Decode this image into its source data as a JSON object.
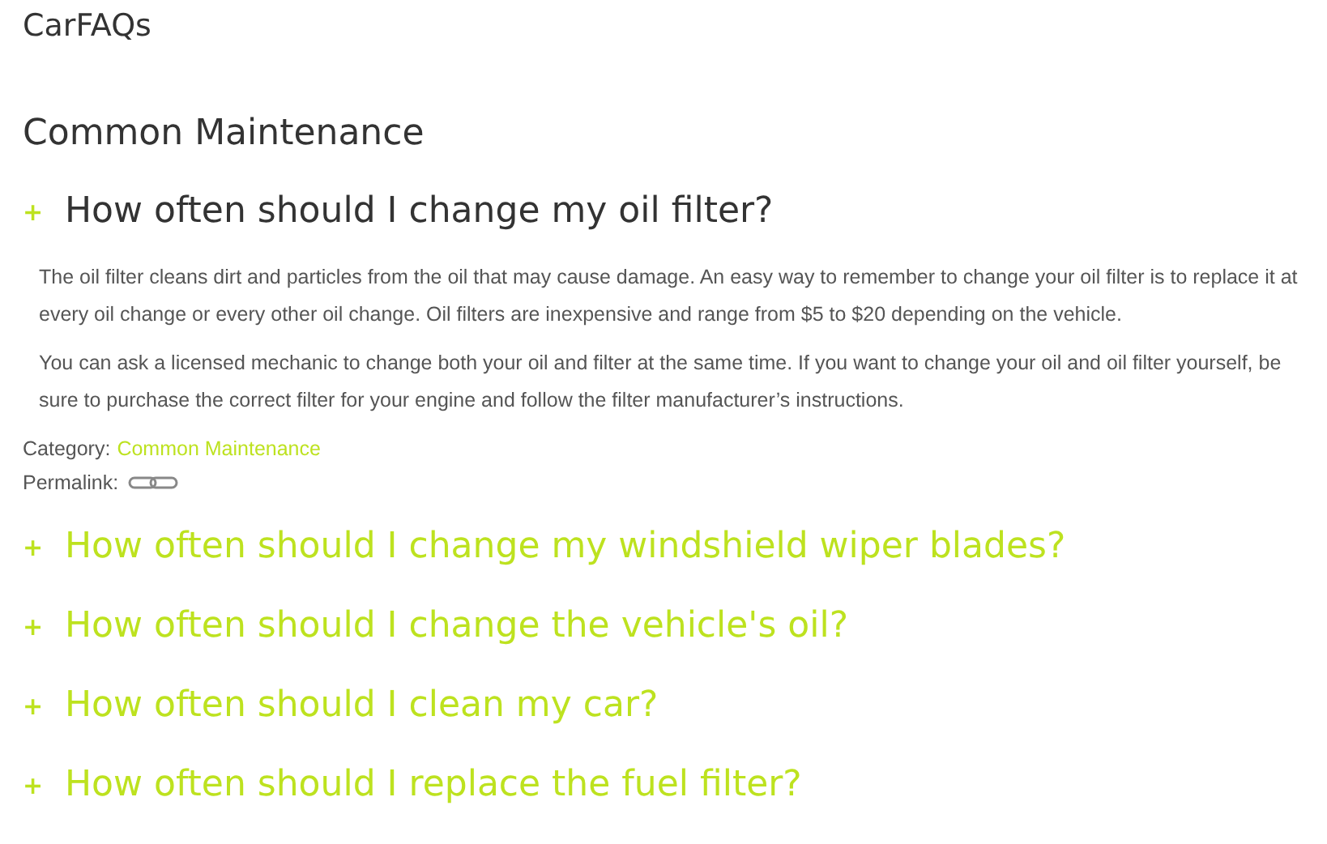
{
  "site_title": "CarFAQs",
  "section_title": "Common Maintenance",
  "faqs": [
    {
      "icon": "+",
      "question": "How often should I change my oil filter?",
      "expanded": true,
      "answer": [
        "The oil filter cleans dirt and particles from the oil that may cause damage. An easy way to remember to change your oil filter is to replace it at every oil change or every other oil change. Oil filters are inexpensive and range from $5 to $20 depending on the vehicle.",
        "You can ask a licensed mechanic to change both your oil and filter at the same time. If you want to change your oil and oil filter yourself, be sure to purchase the correct filter for your engine and follow the filter manufacturer’s instructions."
      ],
      "category_label": "Category:",
      "category": "Common Maintenance",
      "permalink_label": "Permalink:"
    },
    {
      "icon": "+",
      "question": "How often should I change my windshield wiper blades?",
      "expanded": false
    },
    {
      "icon": "+",
      "question": "How often should I change the vehicle's oil?",
      "expanded": false
    },
    {
      "icon": "+",
      "question": "How often should I clean my car?",
      "expanded": false
    },
    {
      "icon": "+",
      "question": "How often should I replace the fuel filter?",
      "expanded": false
    }
  ]
}
